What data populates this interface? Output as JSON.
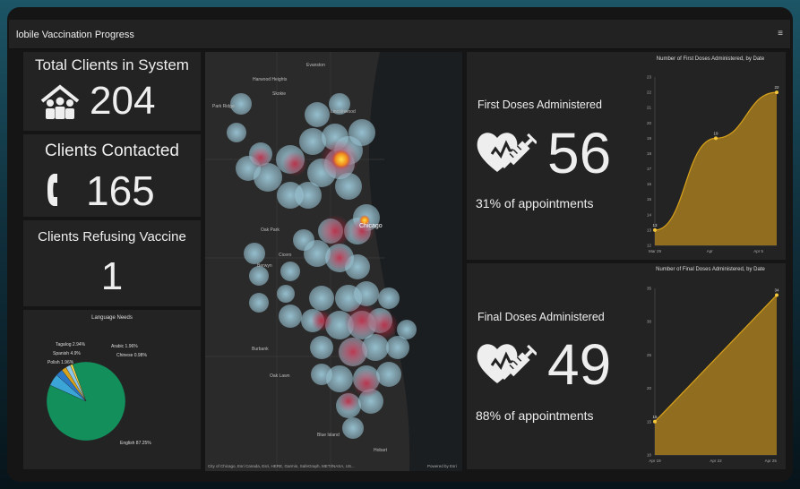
{
  "header": {
    "title": "lobile Vaccination Progress",
    "menu_icon": "menu-icon"
  },
  "kpi": {
    "total_clients": {
      "label": "Total Clients in System",
      "value": "204",
      "icon": "people-house-icon"
    },
    "clients_contacted": {
      "label": "Clients Contacted",
      "value": "165",
      "icon": "phone-icon"
    },
    "clients_refusing": {
      "label": "Clients Refusing Vaccine",
      "value": "1"
    }
  },
  "language_chart": {
    "title": "Language Needs",
    "labels": [
      "Tagalog 2.94%",
      "Arabic 1.96%",
      "Spanish 4.9%",
      "Chinese 0.98%",
      "Polish 1.96%",
      "English 87.25%"
    ]
  },
  "map": {
    "attribution": "City of Chicago, Esri Canada, Esri, HERE, Garmin, SafeGraph, METI/NASA, US...",
    "powered": "Powered by Esri",
    "places": [
      "Evanston",
      "Harwood Heights",
      "Skokie",
      "Chicago",
      "Oak Park",
      "Cicero",
      "Berwyn",
      "Burbank",
      "Oak Lawn",
      "Blue Island",
      "Hobart",
      "Lincolnwood",
      "Park Ridge"
    ]
  },
  "first_doses": {
    "label": "First Doses Administered",
    "value": "56",
    "pct": "31% of appointments",
    "icon": "heart-syringe-icon",
    "chart_title": "Number of First Doses Administered, by Date"
  },
  "final_doses": {
    "label": "Final Doses Administered",
    "value": "49",
    "pct": "88% of appointments",
    "icon": "heart-syringe-icon",
    "chart_title": "Number of Final Doses Administered, by Date"
  },
  "colors": {
    "accent": "#d9a21b",
    "area": "#a47a1e",
    "pie_english": "#128f5b",
    "pie_blue": "#3ba5d8"
  },
  "chart_data": [
    {
      "type": "pie",
      "title": "Language Needs",
      "categories": [
        "English",
        "Spanish",
        "Tagalog",
        "Arabic",
        "Polish",
        "Chinese"
      ],
      "values": [
        87.25,
        4.9,
        2.94,
        1.96,
        1.96,
        0.98
      ]
    },
    {
      "type": "area",
      "title": "Number of First Doses Administered, by Date",
      "x": [
        "Mar 29",
        "Apr",
        "Apr 5"
      ],
      "y": [
        13,
        19,
        22
      ],
      "ylim": [
        12,
        23
      ],
      "yticks": [
        12,
        13,
        14,
        15,
        16,
        17,
        18,
        19,
        20,
        21,
        22,
        23
      ],
      "xticks": [
        "Mar 29",
        "Apr",
        "Apr 5"
      ]
    },
    {
      "type": "area",
      "title": "Number of Final Doses Administered, by Date",
      "x": [
        "Apr 19",
        "Apr 26"
      ],
      "y": [
        15,
        34
      ],
      "ylim": [
        10,
        35
      ],
      "yticks": [
        10,
        15,
        20,
        25,
        30,
        35
      ],
      "xticks": [
        "Apr 19",
        "Apr 22",
        "Apr 25"
      ]
    }
  ]
}
